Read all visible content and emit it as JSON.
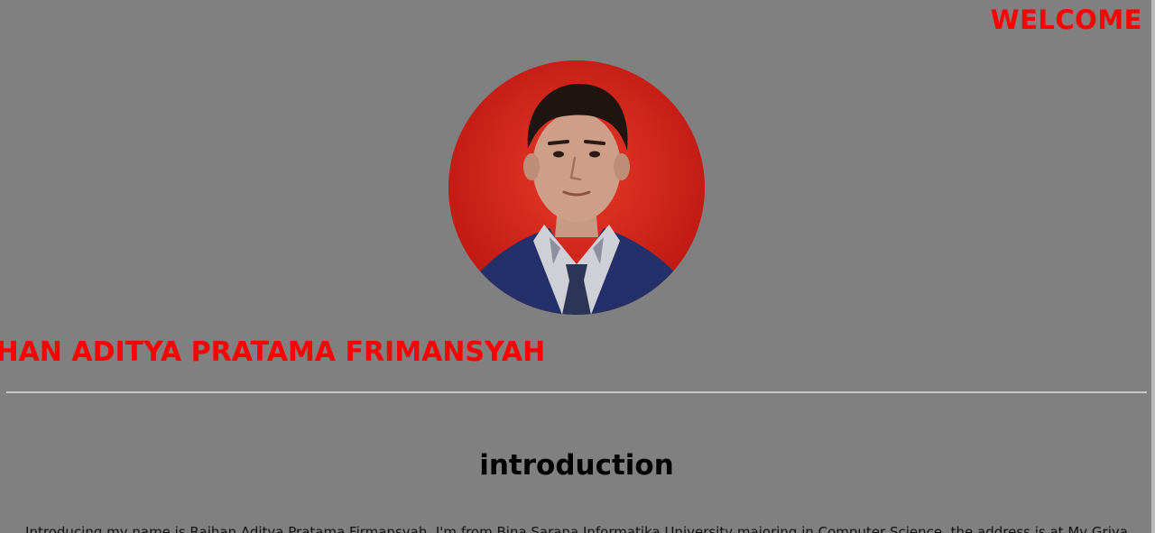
{
  "header": {
    "welcome": "WELCOME"
  },
  "profile": {
    "photo_icon": "profile-photo",
    "name_marquee": "RAIHAN ADITYA PRATAMA FRIMANSYAH"
  },
  "introduction": {
    "title": "introduction",
    "text": "Introducing my name is Raihan Aditya Pratama Firmansyah, I'm from Bina Sarana Informatika University majoring in Computer Science, the address is at My Griya"
  },
  "colors": {
    "background": "#808080",
    "accent": "#ff0000",
    "divider": "#c7c7c7"
  }
}
